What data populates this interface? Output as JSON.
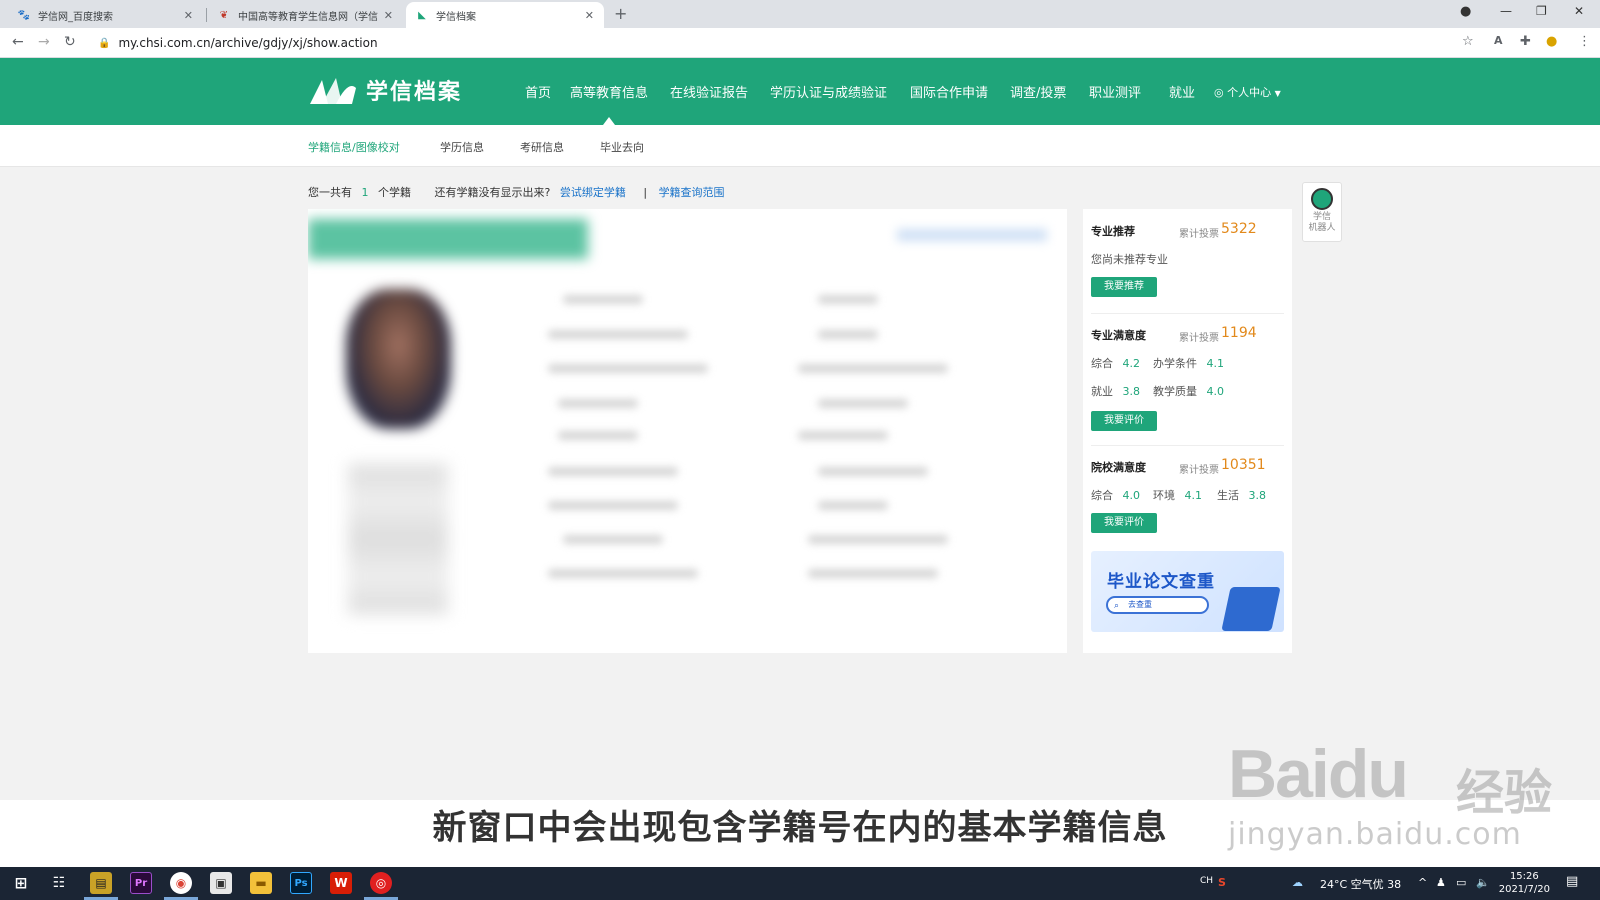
{
  "browser": {
    "tabs": [
      {
        "title": "学信网_百度搜索",
        "active": false
      },
      {
        "title": "中国高等教育学生信息网（学信",
        "active": false
      },
      {
        "title": "学信档案",
        "active": true
      }
    ],
    "new_tab": "+",
    "url": "my.chsi.com.cn/archive/gdjy/xj/show.action",
    "window_controls": {
      "minimize": "—",
      "restore": "❐",
      "close": "✕"
    }
  },
  "site": {
    "logo_text": "学信档案",
    "nav": [
      {
        "label": "首页"
      },
      {
        "label": "高等教育信息"
      },
      {
        "label": "在线验证报告"
      },
      {
        "label": "学历认证与成绩验证"
      },
      {
        "label": "国际合作申请"
      },
      {
        "label": "调查/投票"
      },
      {
        "label": "职业测评"
      },
      {
        "label": "就业"
      },
      {
        "label": "个人中心"
      }
    ],
    "subnav": [
      {
        "label": "学籍信息/图像校对",
        "active": true
      },
      {
        "label": "学历信息",
        "active": false
      },
      {
        "label": "考研信息",
        "active": false
      },
      {
        "label": "毕业去向",
        "active": false
      }
    ]
  },
  "info_line": {
    "prefix": "您一共有",
    "count": "1",
    "suffix": "个学籍",
    "question": "还有学籍没有显示出来?",
    "link1": "尝试绑定学籍",
    "sep": "|",
    "link2": "学籍查询范围"
  },
  "side_panel": {
    "major_recommend": {
      "title": "专业推荐",
      "count_label": "累计投票",
      "count": "5322",
      "empty_text": "您尚未推荐专业",
      "button": "我要推荐"
    },
    "major_satisfaction": {
      "title": "专业满意度",
      "count_label": "累计投票",
      "count": "1194",
      "metrics": [
        {
          "label": "综合",
          "value": "4.2"
        },
        {
          "label": "办学条件",
          "value": "4.1"
        },
        {
          "label": "就业",
          "value": "3.8"
        },
        {
          "label": "教学质量",
          "value": "4.0"
        }
      ],
      "button": "我要评价"
    },
    "school_satisfaction": {
      "title": "院校满意度",
      "count_label": "累计投票",
      "count": "10351",
      "metrics": [
        {
          "label": "综合",
          "value": "4.0"
        },
        {
          "label": "环境",
          "value": "4.1"
        },
        {
          "label": "生活",
          "value": "3.8"
        }
      ],
      "button": "我要评价"
    },
    "banner": {
      "title": "毕业论文查重",
      "button": "去查重"
    }
  },
  "robot": {
    "label_line1": "学信",
    "label_line2": "机器人"
  },
  "overlay": {
    "subtitle": "新窗口中会出现包含学籍号在内的基本学籍信息",
    "watermark_brand": "Baidu",
    "watermark_cn": "经验",
    "watermark_url": "jingyan.baidu.com"
  },
  "taskbar": {
    "tray_lang": "CH",
    "weather": "24°C  空气优 38",
    "time": "15:26",
    "date": "2021/7/20"
  },
  "colors": {
    "brand_green": "#1fa57a",
    "count_orange": "#e2891b",
    "link_blue": "#1a73c9"
  }
}
